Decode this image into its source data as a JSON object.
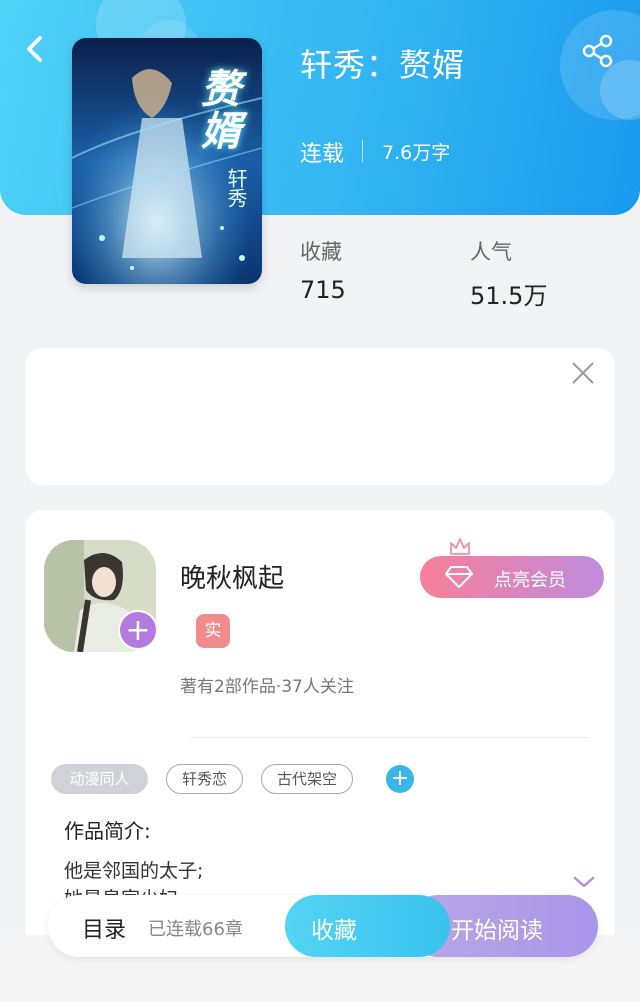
{
  "book": {
    "title": "轩秀：赘婿",
    "status": "连载",
    "word_count": "7.6万字",
    "cover_title": "赘婿",
    "cover_author": "轩秀"
  },
  "stats": {
    "favorites_label": "收藏",
    "favorites_value": "715",
    "popularity_label": "人气",
    "popularity_value": "51.5万"
  },
  "author": {
    "name": "晚秋枫起",
    "badge": "实",
    "meta": "著有2部作品·37人关注",
    "vip_label": "点亮会员"
  },
  "tags": [
    "动漫同人",
    "轩秀恋",
    "古代架空"
  ],
  "intro": {
    "heading": "作品简介:",
    "lines": [
      "他是邻国的太子;",
      "她是皇家少妇"
    ]
  },
  "bottom_bar": {
    "toc_label": "目录",
    "toc_count": "已连载66章",
    "favorite_label": "收藏",
    "read_label": "开始阅读"
  },
  "icons": {
    "back": "chevron-left-icon",
    "share": "share-icon",
    "close": "close-icon",
    "diamond": "diamond-icon",
    "crown": "crown-icon",
    "expand": "chevron-down-icon"
  },
  "colors": {
    "header_start": "#4fd2f6",
    "header_end": "#1a9aee",
    "vip_start": "#f77f98",
    "vip_end": "#c08cde",
    "favorite_button": "#38c2ee",
    "read_button": "#a995ea",
    "tag_add": "#3bb6ea"
  }
}
